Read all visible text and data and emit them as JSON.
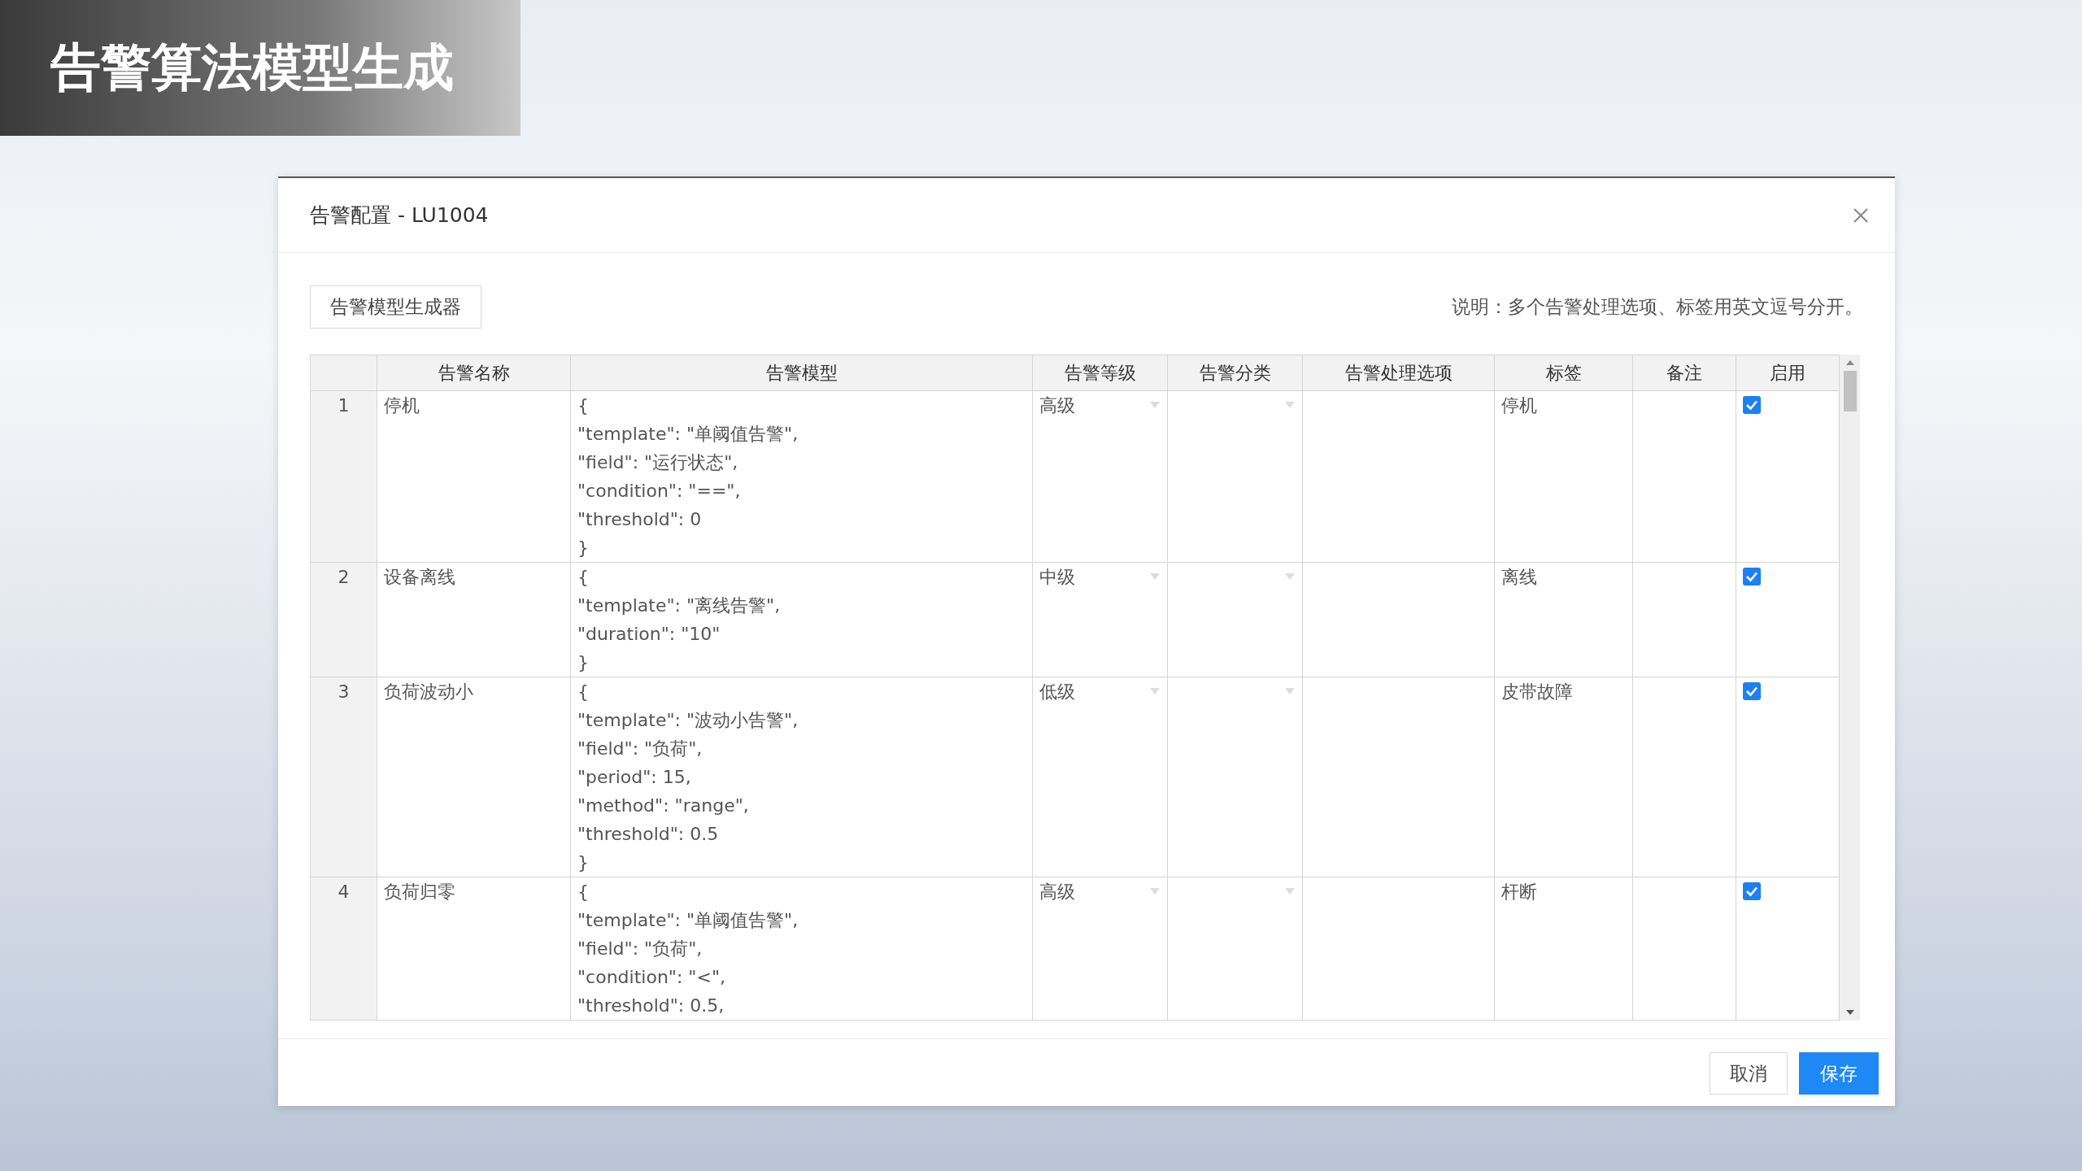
{
  "slide_title": "告警算法模型生成",
  "dialog": {
    "title": "告警配置 - LU1004",
    "generator_button": "告警模型生成器",
    "note": "说明：多个告警处理选项、标签用英文逗号分开。",
    "table": {
      "columns": [
        "告警名称",
        "告警模型",
        "告警等级",
        "告警分类",
        "告警处理选项",
        "标签",
        "备注",
        "启用"
      ],
      "rows": [
        {
          "index": "1",
          "name": "停机",
          "model": [
            "{",
            "\"template\": \"单阈值告警\",",
            "\"field\": \"运行状态\",",
            "\"condition\": \"==\",",
            "\"threshold\": 0",
            "}"
          ],
          "level": "高级",
          "tag": "停机",
          "enabled": true
        },
        {
          "index": "2",
          "name": "设备离线",
          "model": [
            "{",
            "\"template\": \"离线告警\",",
            "\"duration\": \"10\"",
            "}"
          ],
          "level": "中级",
          "tag": "离线",
          "enabled": true
        },
        {
          "index": "3",
          "name": "负荷波动小",
          "model": [
            "{",
            "\"template\": \"波动小告警\",",
            "\"field\": \"负荷\",",
            "\"period\": 15,",
            "\"method\": \"range\",",
            "\"threshold\": 0.5",
            "}"
          ],
          "level": "低级",
          "tag": "皮带故障",
          "enabled": true
        },
        {
          "index": "4",
          "name": "负荷归零",
          "model": [
            "{",
            "\"template\": \"单阈值告警\",",
            "\"field\": \"负荷\",",
            "\"condition\": \"<\",",
            "\"threshold\": 0.5,"
          ],
          "level": "高级",
          "tag": "杆断",
          "enabled": true
        }
      ]
    },
    "buttons": {
      "cancel": "取消",
      "save": "保存"
    }
  }
}
